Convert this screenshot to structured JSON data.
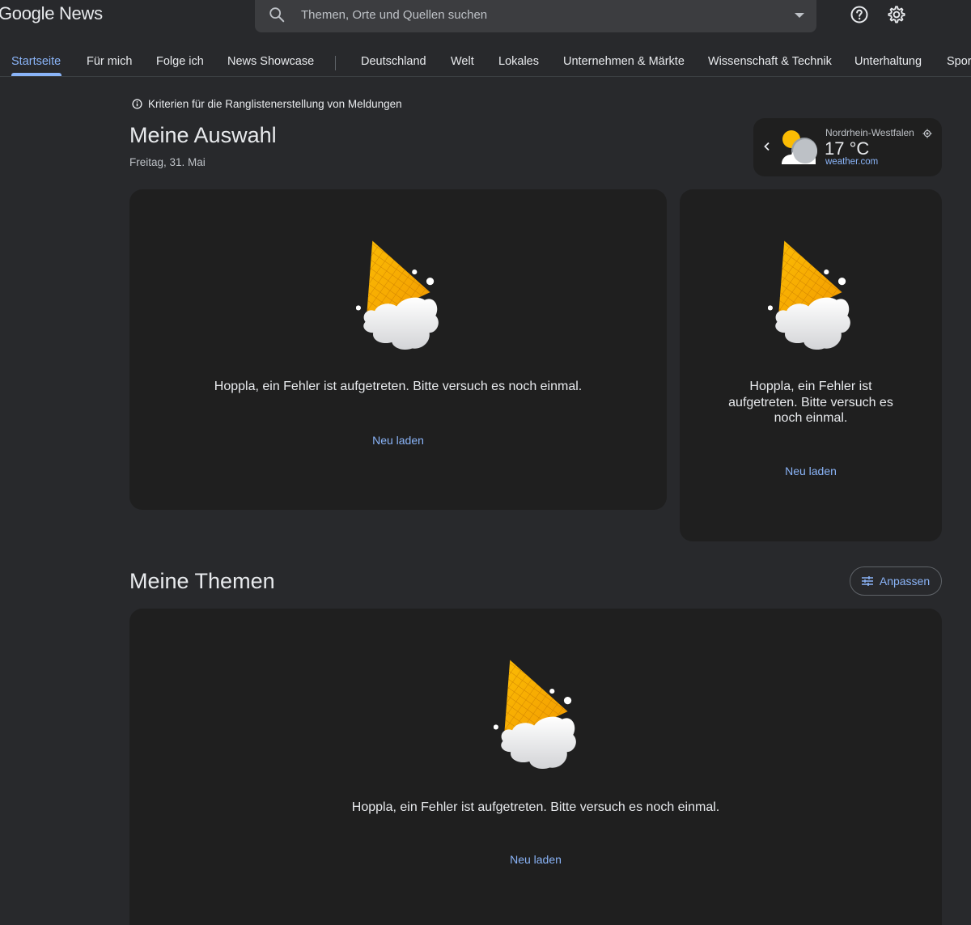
{
  "app": {
    "logo_text": "Google News"
  },
  "search": {
    "placeholder": "Themen, Orte und Quellen suchen"
  },
  "header_icons": [
    "help-icon",
    "settings-icon"
  ],
  "nav": {
    "items": [
      {
        "label": "Startseite",
        "active": true
      },
      {
        "label": "Für mich"
      },
      {
        "label": "Folge ich"
      },
      {
        "label": "News Showcase"
      },
      {
        "label": "Deutschland"
      },
      {
        "label": "Welt"
      },
      {
        "label": "Lokales"
      },
      {
        "label": "Unternehmen & Märkte"
      },
      {
        "label": "Wissenschaft & Technik"
      },
      {
        "label": "Unterhaltung"
      },
      {
        "label": "Sport"
      }
    ]
  },
  "criteria_link": "Kriterien für die Ranglistenerstellung von Meldungen",
  "section1": {
    "title": "Meine Auswahl",
    "date": "Freitag, 31. Mai"
  },
  "weather": {
    "region": "Nordrhein-Westfalen",
    "temperature": "17 °C",
    "source": "weather.com"
  },
  "error": {
    "message": "Hoppla, ein Fehler ist aufgetreten. Bitte versuch es noch einmal.",
    "reload_label": "Neu laden"
  },
  "section2": {
    "title": "Meine Themen",
    "customize_label": "Anpassen"
  },
  "colors": {
    "background": "#28292c",
    "card": "#1f1f1f",
    "accent": "#8ab4f8",
    "cone": "#f9ab00"
  }
}
